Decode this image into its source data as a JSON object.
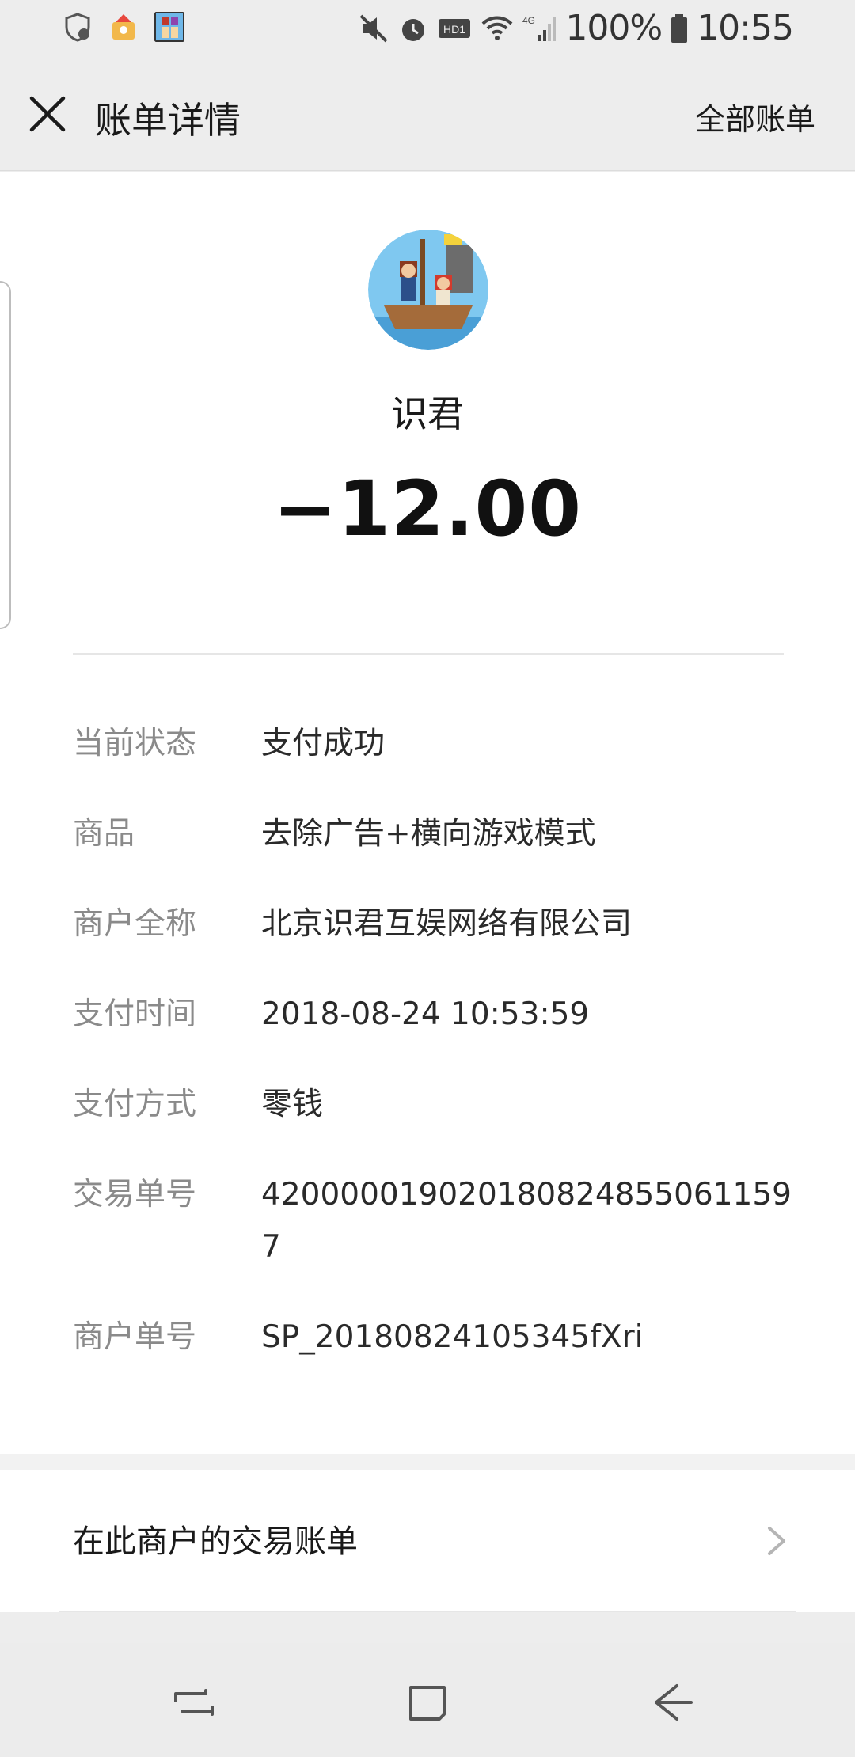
{
  "status_bar": {
    "battery": "100%",
    "time": "10:55",
    "network": "4G",
    "hd_label": "HD1"
  },
  "header": {
    "title": "账单详情",
    "all_bills": "全部账单"
  },
  "transaction": {
    "merchant": "识君",
    "amount": "−12.00"
  },
  "details": [
    {
      "label": "当前状态",
      "value": "支付成功"
    },
    {
      "label": "商品",
      "value": "去除广告+横向游戏模式"
    },
    {
      "label": "商户全称",
      "value": "北京识君互娱网络有限公司"
    },
    {
      "label": "支付时间",
      "value": "2018-08-24 10:53:59"
    },
    {
      "label": "支付方式",
      "value": "零钱"
    },
    {
      "label": "交易单号",
      "value": "4200000190201808248550611597"
    },
    {
      "label": "商户单号",
      "value": "SP_20180824105345fXri"
    }
  ],
  "merchant_link": {
    "label": "在此商户的交易账单"
  },
  "icons": {
    "close": "close-icon",
    "chevron": "chevron-right-icon",
    "nav_recent": "recent-apps-icon",
    "nav_home": "home-icon",
    "nav_back": "back-icon"
  },
  "colors": {
    "background": "#ededed",
    "card": "#ffffff",
    "label": "#8a8a8a",
    "text": "#1a1a1a"
  }
}
